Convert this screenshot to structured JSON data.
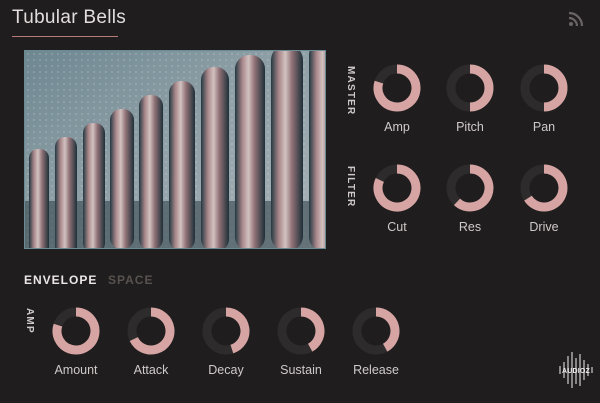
{
  "header": {
    "title": "Tubular Bells",
    "rss_icon": "rss-icon"
  },
  "colors": {
    "accent": "#d6a5a3",
    "track": "#2d2b2c",
    "background": "#1f1d1e",
    "underline": "#b77c7a"
  },
  "sections": {
    "master": "MASTER",
    "filter": "FILTER",
    "amp": "AMP"
  },
  "master_knobs": [
    {
      "label": "Amp",
      "value": 0.8
    },
    {
      "label": "Pitch",
      "value": 0.5
    },
    {
      "label": "Pan",
      "value": 0.5
    }
  ],
  "filter_knobs": [
    {
      "label": "Cut",
      "value": 0.82
    },
    {
      "label": "Res",
      "value": 0.62
    },
    {
      "label": "Drive",
      "value": 0.66
    }
  ],
  "tabs": {
    "envelope": "ENVELOPE",
    "space": "SPACE"
  },
  "envelope_knobs": [
    {
      "label": "Amount",
      "value": 0.8
    },
    {
      "label": "Attack",
      "value": 0.68
    },
    {
      "label": "Decay",
      "value": 0.45
    },
    {
      "label": "Sustain",
      "value": 0.42
    },
    {
      "label": "Release",
      "value": 0.42
    }
  ],
  "watermark": "AUDIOZ"
}
